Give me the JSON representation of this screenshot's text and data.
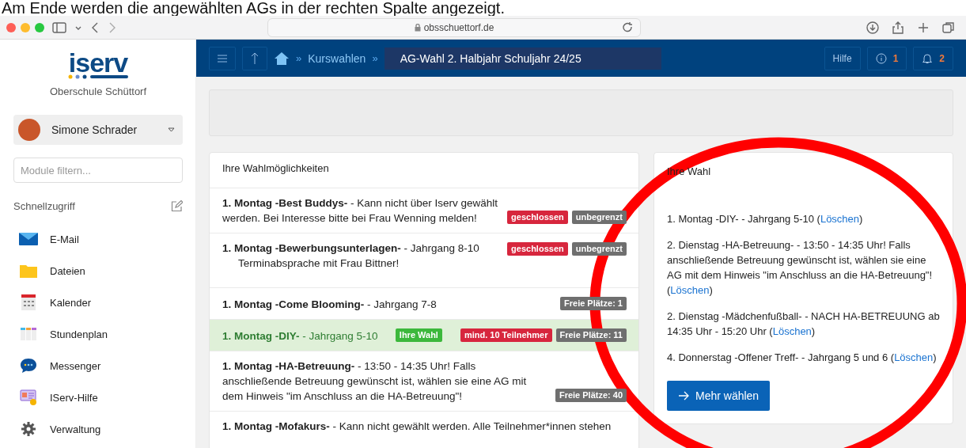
{
  "caption": "Am Ende werden die angewählten AGs in der rechten Spalte angezeigt.",
  "browser": {
    "address": "obsschuettorf.de"
  },
  "sidebar": {
    "logo": "iserv",
    "school": "Oberschule Schüttorf",
    "user": "Simone Schrader",
    "filter": {
      "placeholder": "Module filtern..."
    },
    "section": "Schnellzugriff",
    "items": [
      {
        "label": "E-Mail"
      },
      {
        "label": "Dateien"
      },
      {
        "label": "Kalender"
      },
      {
        "label": "Stundenplan"
      },
      {
        "label": "Messenger"
      },
      {
        "label": "IServ-Hilfe"
      },
      {
        "label": "Verwaltung"
      }
    ]
  },
  "header": {
    "breadcrumb": [
      {
        "sep": "»",
        "label": "Kurswahlen"
      }
    ],
    "title_sep": "»",
    "title": "AG-Wahl 2. Halbjahr Schuljahr 24/25",
    "help": "Hilfe",
    "info_count": "1",
    "notification_count": "2"
  },
  "options": {
    "title": "Ihre Wahlmöglichkeiten",
    "rows": [
      {
        "text": "**1. Montag -Best Buddys-** - Kann nicht über Iserv gewählt werden. Bei Interesse bitte bei Frau Wenning melden!",
        "selected": false,
        "badges": [
          {
            "label": "geschlossen",
            "kind": "danger"
          },
          {
            "label": "unbegrenzt",
            "kind": "secondary"
          }
        ]
      },
      {
        "text": "**1. Montag -Bewerbungsunterlagen-** - Jahrgang 8-10",
        "note": "Terminabsprache mit Frau Bittner!",
        "selected": false,
        "badges": [
          {
            "label": "geschlossen",
            "kind": "danger"
          },
          {
            "label": "unbegrenzt",
            "kind": "secondary"
          }
        ]
      },
      {
        "text": "**1. Montag -Come Blooming-** - Jahrgang 7-8",
        "selected": false,
        "badges": [
          {
            "label": "Freie Plätze: 1",
            "kind": "secondary"
          }
        ]
      },
      {
        "text": "**1. Montag -DIY-** - Jahrgang 5-10",
        "selected": true,
        "badges": [
          {
            "label": "Ihre Wahl",
            "kind": "success"
          },
          {
            "label": "mind. 10 Teilnehmer",
            "kind": "danger"
          },
          {
            "label": "Freie Plätze: 11",
            "kind": "secondary"
          }
        ]
      },
      {
        "text": "**1. Montag -HA-Betreuung-** - 13:50 - 14:35 Uhr! Falls anschließende Betreuung gewünscht ist, wählen sie eine AG mit dem Hinweis \"im Anschluss an die HA-Betreuung\"!",
        "selected": false,
        "badges": [
          {
            "label": "Freie Plätze: 40",
            "kind": "secondary"
          }
        ]
      },
      {
        "text": "**1. Montag -Mofakurs-** - Kann nicht gewählt werden. Alle Teilnehmer*innen stehen",
        "selected": false
      }
    ]
  },
  "choices": {
    "title": "Ihre Wahl",
    "items": [
      {
        "text": "1. Montag -DIY- - Jahrgang 5-10 (",
        "link": "Löschen",
        "after": ")"
      },
      {
        "text": "2. Dienstag -HA-Betreuung- - 13:50 - 14:35 Uhr! Falls anschließende Betreuung gewünscht ist, wählen sie eine AG mit dem Hinweis \"im Anschluss an die HA-Betreuung\"! (",
        "link": "Löschen",
        "after": ")"
      },
      {
        "text": "2. Dienstag -Mädchenfußball- - NACH HA-BETREUUNG ab 14:35 Uhr - 15:20 Uhr (",
        "link": "Löschen",
        "after": ")"
      },
      {
        "text": "4. Donnerstag -Offener Treff- - Jahrgang 5 und 6 (",
        "link": "Löschen",
        "after": ")"
      }
    ],
    "button": "Mehr wählen"
  }
}
